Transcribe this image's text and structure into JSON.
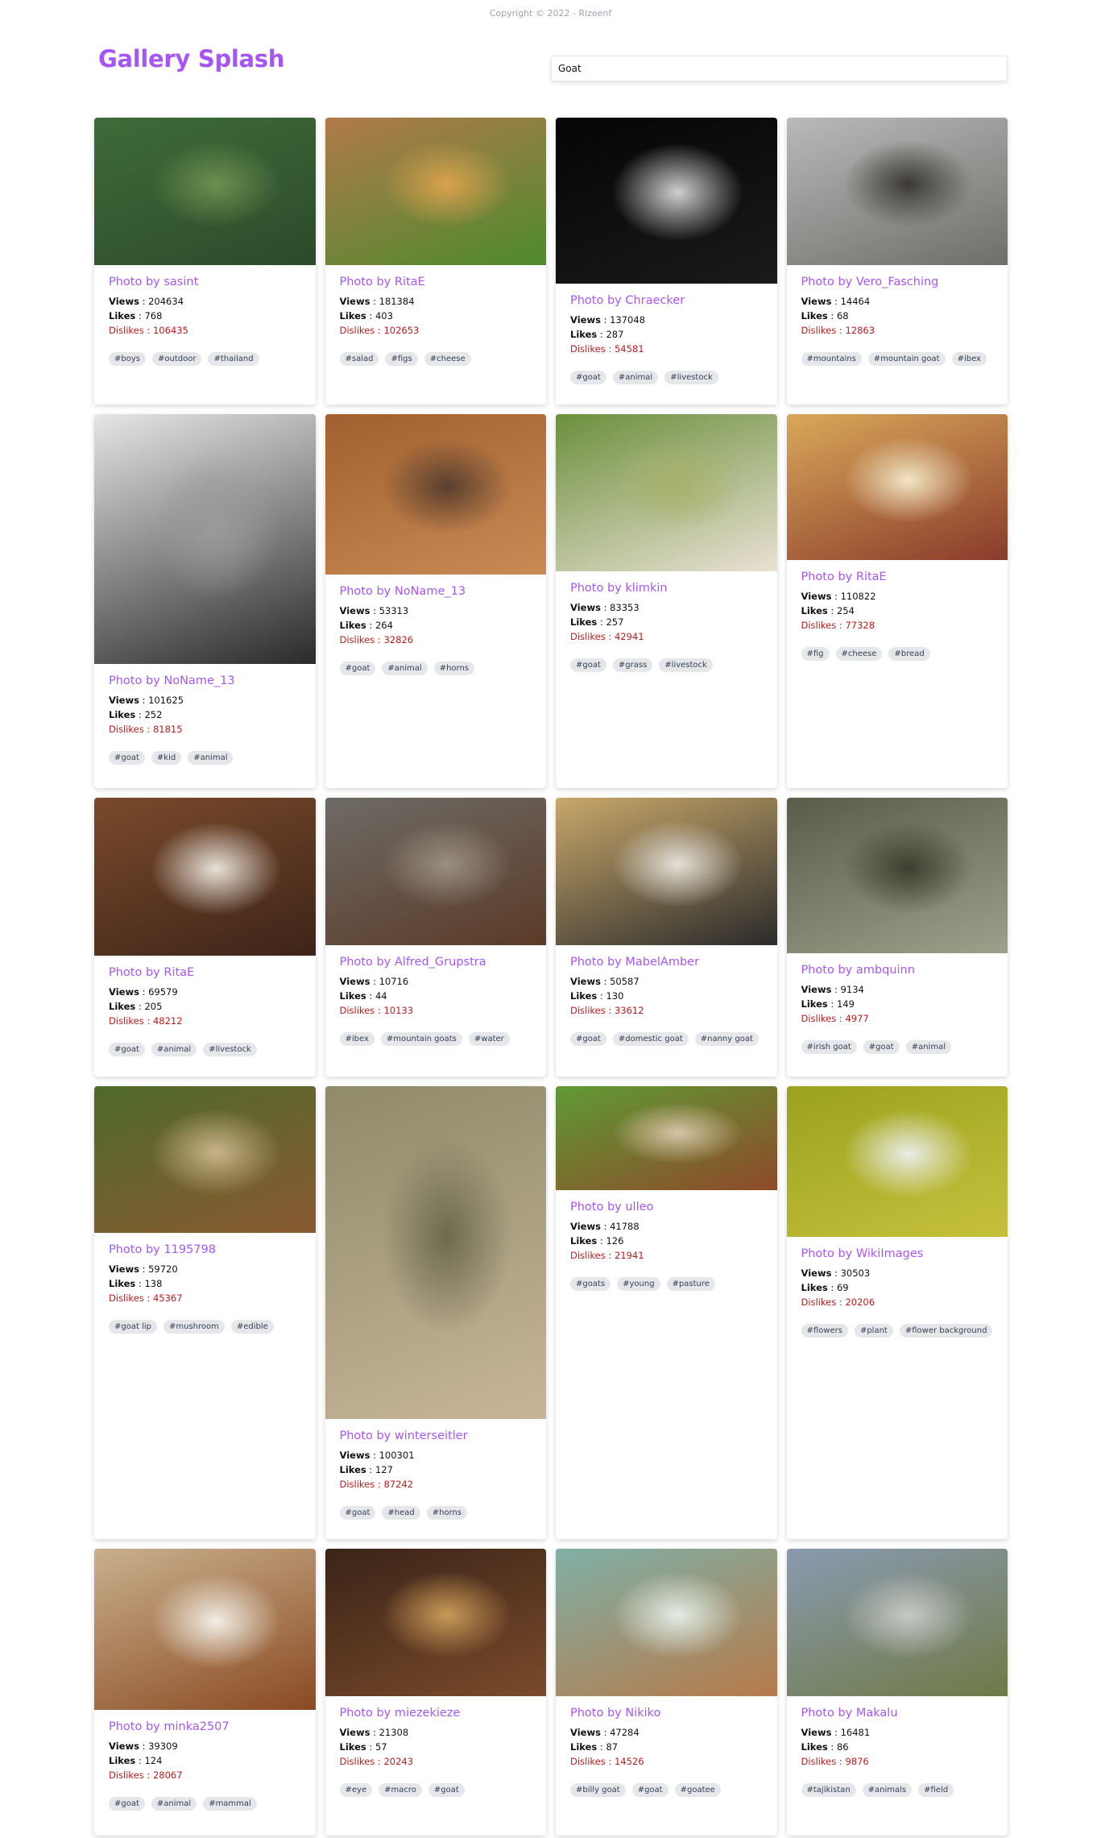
{
  "footer": {
    "copyright": "Copyright © 2022 - Rizeenf"
  },
  "header": {
    "title": "Gallery Splash"
  },
  "search": {
    "value": "Goat",
    "placeholder": ""
  },
  "labels": {
    "views": "Views",
    "likes": "Likes",
    "dislikes": "Dislikes"
  },
  "rows": [
    {
      "cards": [
        {
          "user": "Photo by sasint",
          "views": "204634",
          "likes": "768",
          "dislikes": "106435",
          "tags": [
            "#boys",
            "#outdoor",
            "#thailand"
          ],
          "photo": "boy holding a baby goat in a forest",
          "colors": [
            "#3f6b3a",
            "#2c4a2a",
            "#6b8f4e"
          ]
        },
        {
          "user": "Photo by RitaE",
          "views": "181384",
          "likes": "403",
          "dislikes": "102653",
          "tags": [
            "#salad",
            "#figs",
            "#cheese"
          ],
          "photo": "salad with figs and cheese",
          "colors": [
            "#b07a4a",
            "#4e8a2f",
            "#d9a24d"
          ]
        },
        {
          "user": "Photo by Chraecker",
          "views": "137048",
          "likes": "287",
          "dislikes": "54581",
          "tags": [
            "#goat",
            "#animal",
            "#livestock"
          ],
          "photo": "white goat on black background",
          "colors": [
            "#050505",
            "#1a1a1a",
            "#cfcfcf"
          ]
        },
        {
          "user": "Photo by Vero_Fasching",
          "views": "14464",
          "likes": "68",
          "dislikes": "12863",
          "tags": [
            "#mountains",
            "#mountain goat",
            "#ibex"
          ],
          "photo": "misty mountain ridge with ibex",
          "colors": [
            "#b8babb",
            "#6f6e68",
            "#3c3a33"
          ]
        }
      ]
    },
    {
      "cards": [
        {
          "user": "Photo by NoName_13",
          "views": "101625",
          "likes": "252",
          "dislikes": "81815",
          "tags": [
            "#goat",
            "#kid",
            "#animal"
          ],
          "photo": "black and white goat portrait",
          "colors": [
            "#e6e6e6",
            "#2a2a2a",
            "#9a9a9a"
          ]
        },
        {
          "user": "Photo by NoName_13",
          "views": "53313",
          "likes": "264",
          "dislikes": "32826",
          "tags": [
            "#goat",
            "#animal",
            "#horns"
          ],
          "photo": "brown goat face close up",
          "colors": [
            "#a0602f",
            "#c98b55",
            "#5a3f2e"
          ]
        },
        {
          "user": "Photo by klimkin",
          "views": "83353",
          "likes": "257",
          "dislikes": "42941",
          "tags": [
            "#goat",
            "#grass",
            "#livestock"
          ],
          "photo": "white goat eating grass",
          "colors": [
            "#6c8f3c",
            "#e9e1d3",
            "#a8b26b"
          ]
        },
        {
          "user": "Photo by RitaE",
          "views": "110822",
          "likes": "254",
          "dislikes": "77328",
          "tags": [
            "#fig",
            "#cheese",
            "#bread"
          ],
          "photo": "bread slices with fig and cheese",
          "colors": [
            "#d9a85a",
            "#8a3b2a",
            "#f2e5c4"
          ]
        }
      ]
    },
    {
      "cards": [
        {
          "user": "Photo by RitaE",
          "views": "69579",
          "likes": "205",
          "dislikes": "48212",
          "tags": [
            "#goat",
            "#animal",
            "#livestock"
          ],
          "photo": "goat head in a barn",
          "colors": [
            "#7a4a2c",
            "#3d2418",
            "#e8e2d8"
          ]
        },
        {
          "user": "Photo by Alfred_Grupstra",
          "views": "10716",
          "likes": "44",
          "dislikes": "10133",
          "tags": [
            "#ibex",
            "#mountain goats",
            "#water"
          ],
          "photo": "two ibex fighting with horns",
          "colors": [
            "#6d6b66",
            "#5b3a27",
            "#9a8f80"
          ]
        },
        {
          "user": "Photo by MabelAmber",
          "views": "50587",
          "likes": "130",
          "dislikes": "33612",
          "tags": [
            "#goat",
            "#domestic goat",
            "#nanny goat"
          ],
          "photo": "goat lying in straw",
          "colors": [
            "#c9a86a",
            "#2b2b2b",
            "#e4e0d8"
          ]
        },
        {
          "user": "Photo by ambquinn",
          "views": "9134",
          "likes": "149",
          "dislikes": "4977",
          "tags": [
            "#irish goat",
            "#goat",
            "#animal"
          ],
          "photo": "long haired goat with large horns",
          "colors": [
            "#5a5b48",
            "#9fa08c",
            "#3d3f30"
          ]
        }
      ]
    },
    {
      "cards": [
        {
          "user": "Photo by 1195798",
          "views": "59720",
          "likes": "138",
          "dislikes": "45367",
          "tags": [
            "#goat lip",
            "#mushroom",
            "#edible"
          ],
          "photo": "mushroom with snails among leaves",
          "colors": [
            "#4e6a2a",
            "#8a5a32",
            "#c9b489"
          ]
        },
        {
          "user": "Photo by winterseitler",
          "views": "100301",
          "likes": "127",
          "dislikes": "87242",
          "tags": [
            "#goat",
            "#head",
            "#horns"
          ],
          "photo": "young ibex head with horns",
          "colors": [
            "#8f8a6a",
            "#c7b59a",
            "#6e6a4e"
          ]
        },
        {
          "user": "Photo by ulleo",
          "views": "41788",
          "likes": "126",
          "dislikes": "21941",
          "tags": [
            "#goats",
            "#young",
            "#pasture"
          ],
          "photo": "two brown goats in pasture",
          "colors": [
            "#5f9a34",
            "#8e4a2a",
            "#d6c3a6"
          ]
        },
        {
          "user": "Photo by WikiImages",
          "views": "30503",
          "likes": "69",
          "dislikes": "20206",
          "tags": [
            "#flowers",
            "#plant",
            "#flower background"
          ],
          "photo": "willow catkins on green background",
          "colors": [
            "#9aa21e",
            "#c6c03c",
            "#e9ede6"
          ]
        }
      ]
    },
    {
      "cards": [
        {
          "user": "Photo by minka2507",
          "views": "39309",
          "likes": "124",
          "dislikes": "28067",
          "tags": [
            "#goat",
            "#animal",
            "#mammal"
          ],
          "photo": "brown and white goat",
          "colors": [
            "#c9b08d",
            "#8a4a22",
            "#f2ede4"
          ]
        },
        {
          "user": "Photo by miezekieze",
          "views": "21308",
          "likes": "57",
          "dislikes": "20243",
          "tags": [
            "#eye",
            "#macro",
            "#goat"
          ],
          "photo": "macro of a goat eye",
          "colors": [
            "#3a2418",
            "#7a4a2a",
            "#c89a58"
          ]
        },
        {
          "user": "Photo by Nikiko",
          "views": "47284",
          "likes": "87",
          "dislikes": "14526",
          "tags": [
            "#billy goat",
            "#goat",
            "#goatee"
          ],
          "photo": "billy goat standing in snow",
          "colors": [
            "#7fb0a6",
            "#b67a4a",
            "#e3ece6"
          ]
        },
        {
          "user": "Photo by Makalu",
          "views": "16481",
          "likes": "86",
          "dislikes": "9876",
          "tags": [
            "#tajikistan",
            "#animals",
            "#field"
          ],
          "photo": "mountain valley with grazing animals",
          "colors": [
            "#8a9ab0",
            "#6f7a46",
            "#c7c9c6"
          ]
        }
      ]
    }
  ]
}
